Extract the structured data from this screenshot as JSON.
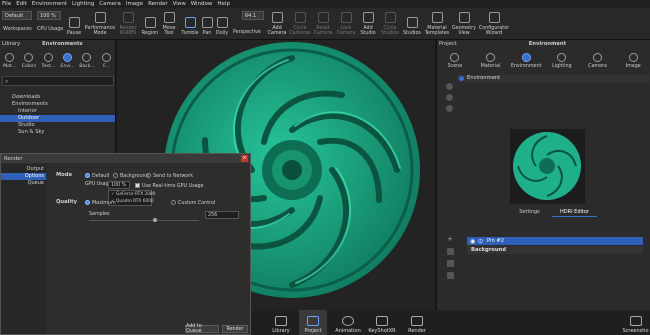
{
  "menu": [
    "File",
    "Edit",
    "Environment",
    "Lighting",
    "Camera",
    "Image",
    "Render",
    "View",
    "Window",
    "Help"
  ],
  "toolbar": {
    "workspace_value": "Default",
    "workspace_label": "Workspaces",
    "cpu_value": "100 %",
    "cpu_label": "CPU Usage",
    "pause_label": "Pause",
    "perf_label": "Performance\nMode",
    "nurbs_label": "Render\nNURBS",
    "region_label": "Region",
    "move_label": "Move\nTool",
    "tumble_label": "Tumble",
    "pan_label": "Pan",
    "dolly_label": "Dolly",
    "persp_value": "64.1",
    "persp_label": "Perspective",
    "addcam_label": "Add\nCamera",
    "cycle_label": "Cycle\nCameras",
    "reset_label": "Reset\nCamera",
    "lock_label": "Lock\nCamera",
    "addstudio_label": "Add\nStudio",
    "cyclestudio_label": "Cycle\nStudios",
    "studios_label": "Studios",
    "matt_label": "Material\nTemplates",
    "geo_label": "Geometry\nView",
    "config_label": "Configurator\nWizard"
  },
  "library": {
    "title": "Library",
    "section": "Environments",
    "tabs": [
      "Mat...",
      "Colors",
      "Text...",
      "Envi...",
      "Back...",
      "F..."
    ],
    "active_tab": 3,
    "tree": [
      "Downloads",
      "Environments",
      "Interior",
      "Outdoor",
      "Studio",
      "Sun & Sky"
    ]
  },
  "project": {
    "title": "Project",
    "section": "Environment",
    "tabs": [
      "Scene",
      "Material",
      "Environment",
      "Lighting",
      "Camera",
      "Image"
    ],
    "active_tab": 2,
    "env_item": "Environment",
    "subtabs": [
      "Settings",
      "HDRI Editor"
    ],
    "list": [
      "Pin #2",
      "Background"
    ]
  },
  "render": {
    "title": "Render",
    "nav": [
      "Output",
      "Options",
      "Queue"
    ],
    "mode_label": "Mode",
    "modes": [
      "Default",
      "Background",
      "Send to Network"
    ],
    "gpu_label": "GPU Usage",
    "gpu_value": "100 %",
    "realtime_label": "Use Real-time GPU Usage",
    "gpu_devices": [
      "GeForce RTX 2080",
      "Quadro RTX 6000"
    ],
    "quality_label": "Quality",
    "qualities": [
      "Maximum",
      "Custom Control"
    ],
    "samples_label": "Samples",
    "samples_value": "256",
    "add_queue": "Add to Queue",
    "render_btn": "Render"
  },
  "dock": [
    "Library",
    "Project",
    "Animation",
    "KeyShotXR",
    "Render"
  ],
  "dock_active": 1,
  "screenshot_label": "Screensho",
  "colors": {
    "accent": "#3a6fd0",
    "object": "#1fb08a"
  }
}
